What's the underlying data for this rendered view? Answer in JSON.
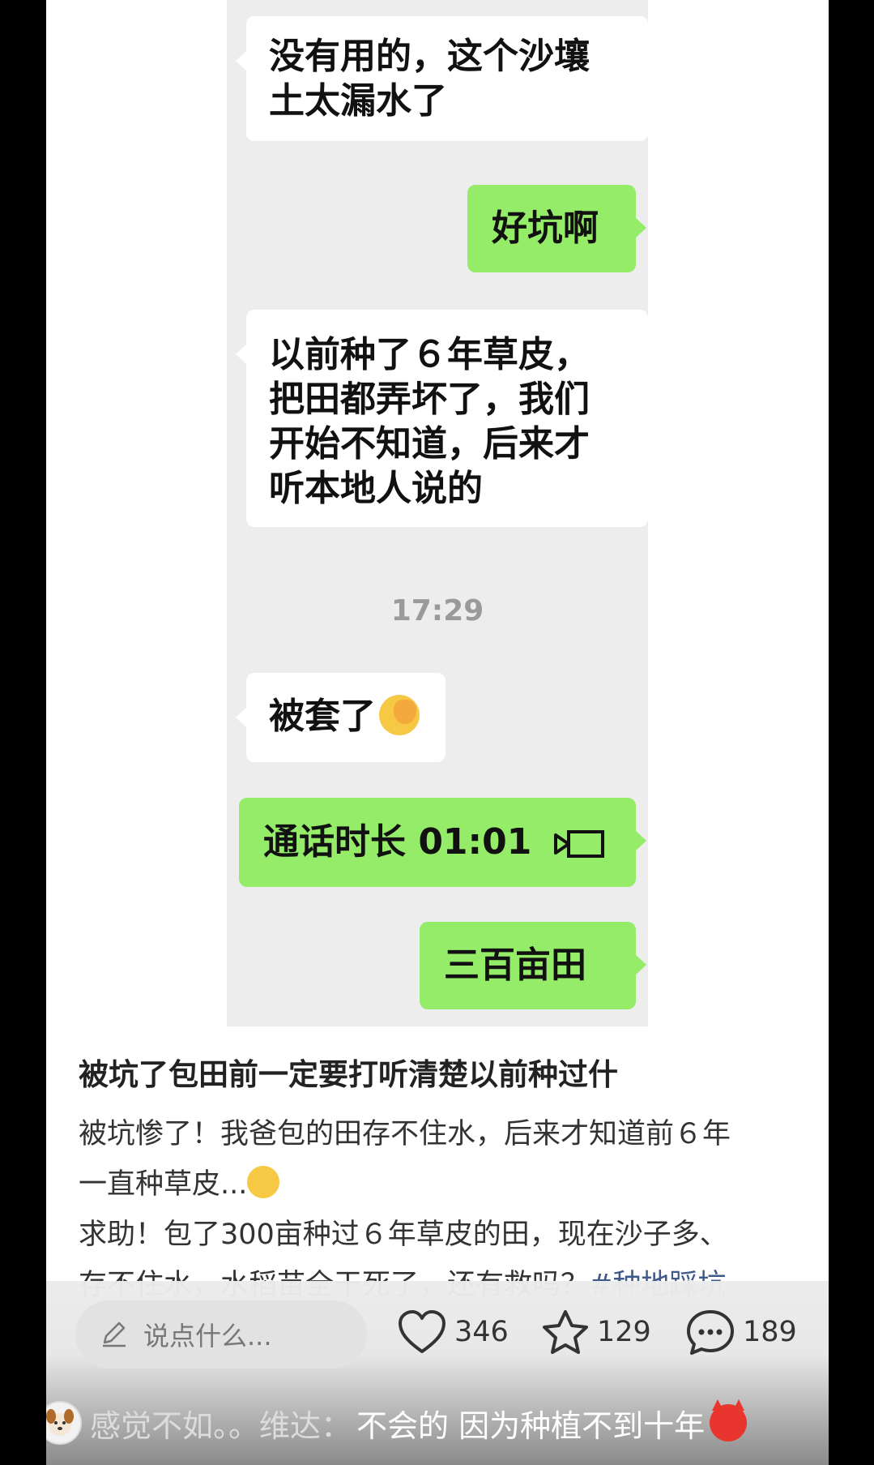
{
  "chat": {
    "messages": [
      {
        "side": "left",
        "text_line1": "没有用的，这个沙壤",
        "text_line2": "土太漏水了"
      },
      {
        "side": "right",
        "text": "好坑啊"
      },
      {
        "side": "left",
        "lines": [
          "以前种了６年草皮，",
          "把田都弄坏了，我们",
          "开始不知道，后来才",
          "听本地人说的"
        ]
      },
      {
        "side": "left",
        "text": "被套了",
        "emoji": "face-with-hand-over-eyes"
      },
      {
        "side": "right",
        "text": "通话时长 01:01",
        "icon": "video-call-icon"
      },
      {
        "side": "right",
        "text": "三百亩田"
      }
    ],
    "time": "17:29"
  },
  "post": {
    "title": "被坑了包田前一定要打听清楚以前种过什",
    "body_line1": "被坑惨了！我爸包的田存不住水，后来才知道前６年",
    "body_line2": "一直种草皮...",
    "body_line2_emoji": "crying-face",
    "body_line3": "求助！包了300亩种过６年草皮的田，现在沙子多、",
    "body_line4_partial": "存不住水，水稻苗全干死了，还有救吗？",
    "hashtag_partial": "#种地踩坑"
  },
  "bottom": {
    "comment_placeholder": "说点什么...",
    "likes": "346",
    "favorites": "129",
    "comments": "189",
    "danmaku_user": "感觉不如。。维达：",
    "danmaku_text": "不会的 因为种植不到十年",
    "danmaku_emoji": "angry-devil"
  },
  "colors": {
    "wechat_green": "#95ec69",
    "chat_bg": "#ededed",
    "hashtag": "#3d5a8a"
  }
}
